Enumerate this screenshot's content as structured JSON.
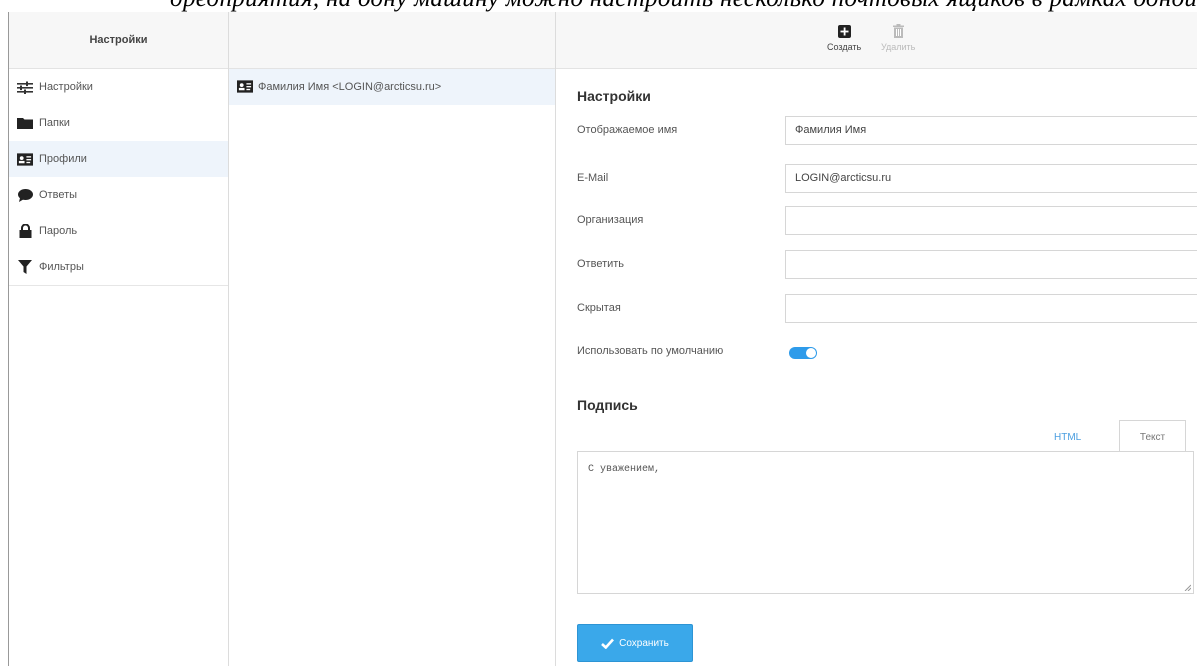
{
  "caption": "дредприятия, на одну машину можно настроить несколько почтовых ящиков в рамках одной учётной записи Windows в рамках группу",
  "nav": {
    "header": "Настройки",
    "items": [
      {
        "label": "Настройки",
        "icon": "sliders-icon"
      },
      {
        "label": "Папки",
        "icon": "folder-icon"
      },
      {
        "label": "Профили",
        "icon": "id-card-icon",
        "active": true
      },
      {
        "label": "Ответы",
        "icon": "speech-bubble-icon"
      },
      {
        "label": "Пароль",
        "icon": "lock-icon"
      },
      {
        "label": "Фильтры",
        "icon": "filter-icon"
      }
    ]
  },
  "profiles": {
    "items": [
      {
        "label": "Фамилия Имя <LOGIN@arcticsu.ru>",
        "icon": "id-card-icon"
      }
    ]
  },
  "toolbar": {
    "create_label": "Создать",
    "delete_label": "Удалить"
  },
  "form": {
    "section_title": "Настройки",
    "fields": {
      "display_name": {
        "label": "Отображаемое имя",
        "value": "Фамилия Имя"
      },
      "email": {
        "label": "E-Mail",
        "value": "LOGIN@arcticsu.ru"
      },
      "organization": {
        "label": "Организация",
        "value": ""
      },
      "reply_to": {
        "label": "Ответить",
        "value": ""
      },
      "bcc": {
        "label": "Скрытая",
        "value": ""
      }
    },
    "default_toggle": {
      "label": "Использовать по умолчанию",
      "on": true
    }
  },
  "signature": {
    "title": "Подпись",
    "tab_html": "HTML",
    "tab_text": "Текст",
    "text": "С уважением,"
  },
  "save_label": "Сохранить",
  "colors": {
    "accent": "#3aa8ea",
    "selected_bg": "#eef4fb"
  }
}
